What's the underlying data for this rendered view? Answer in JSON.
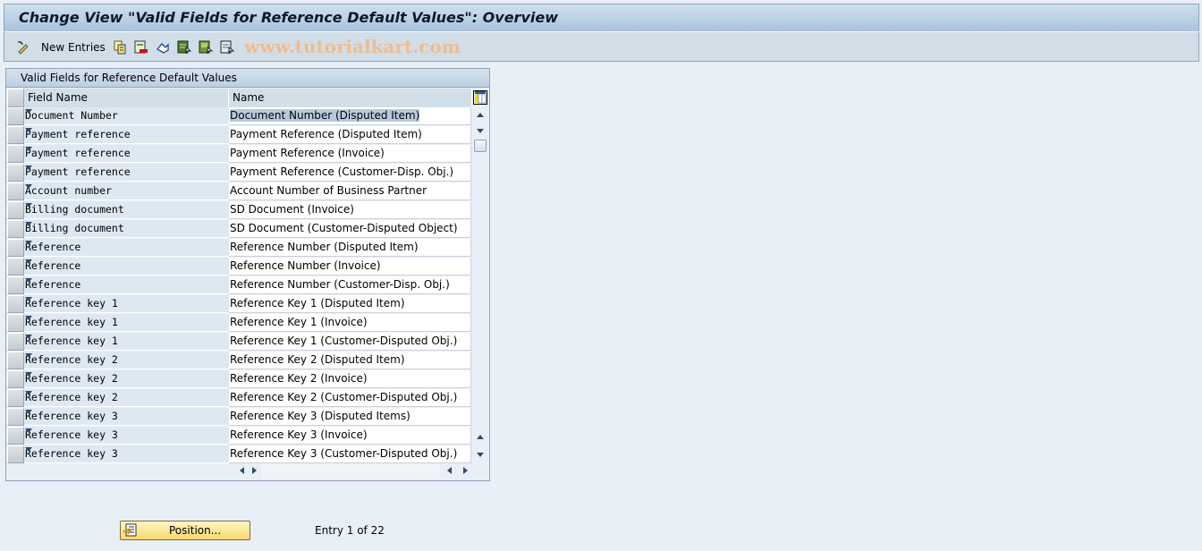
{
  "window": {
    "title": "Change View \"Valid Fields for Reference Default Values\": Overview"
  },
  "toolbar": {
    "items": [
      {
        "icon": "display-change-icon",
        "label": ""
      },
      {
        "icon": "new-entries-icon",
        "label": "New Entries"
      },
      {
        "icon": "copy-as-icon",
        "label": ""
      },
      {
        "icon": "delete-icon",
        "label": ""
      },
      {
        "icon": "undo-change-icon",
        "label": ""
      },
      {
        "icon": "select-all-icon",
        "label": ""
      },
      {
        "icon": "select-block-icon",
        "label": ""
      },
      {
        "icon": "deselect-all-icon",
        "label": ""
      }
    ],
    "watermark": "www.tutorialkart.com"
  },
  "table": {
    "title": "Valid Fields for Reference Default Values",
    "columns": [
      "Field Name",
      "Name"
    ],
    "rows": [
      {
        "field": "Document Number",
        "name": "Document Number (Disputed Item)",
        "selected": true
      },
      {
        "field": "Payment reference",
        "name": "Payment Reference (Disputed Item)"
      },
      {
        "field": "Payment reference",
        "name": "Payment Reference (Invoice)"
      },
      {
        "field": "Payment reference",
        "name": "Payment Reference (Customer-Disp. Obj.)"
      },
      {
        "field": "Account number",
        "name": "Account Number of Business Partner"
      },
      {
        "field": "Billing document",
        "name": "SD Document (Invoice)"
      },
      {
        "field": "Billing document",
        "name": "SD Document (Customer-Disputed Object)"
      },
      {
        "field": "Reference",
        "name": "Reference Number (Disputed Item)"
      },
      {
        "field": "Reference",
        "name": "Reference Number (Invoice)"
      },
      {
        "field": "Reference",
        "name": "Reference Number (Customer-Disp. Obj.)"
      },
      {
        "field": "Reference key 1",
        "name": "Reference Key 1 (Disputed Item)"
      },
      {
        "field": "Reference key 1",
        "name": "Reference Key 1 (Invoice)"
      },
      {
        "field": "Reference key 1",
        "name": "Reference Key 1 (Customer-Disputed Obj.)"
      },
      {
        "field": "Reference key 2",
        "name": "Reference Key 2 (Disputed Item)"
      },
      {
        "field": "Reference key 2",
        "name": "Reference Key 2 (Invoice)"
      },
      {
        "field": "Reference key 2",
        "name": "Reference Key 2 (Customer-Disputed Obj.)"
      },
      {
        "field": "Reference key 3",
        "name": "Reference Key 3 (Disputed Items)"
      },
      {
        "field": "Reference key 3",
        "name": "Reference Key 3 (Invoice)"
      },
      {
        "field": "Reference key 3",
        "name": "Reference Key 3 (Customer-Disputed Obj.)"
      }
    ]
  },
  "footer": {
    "position_button": "Position...",
    "entry_info": "Entry 1 of 22"
  },
  "colors": {
    "background": "#e9eff7",
    "header_band": "#a9c3dc",
    "field_cell": "#dde8f2",
    "selection": "#b6c9dd",
    "button_yellow": "#f7d96a",
    "watermark": "#f2b987"
  }
}
